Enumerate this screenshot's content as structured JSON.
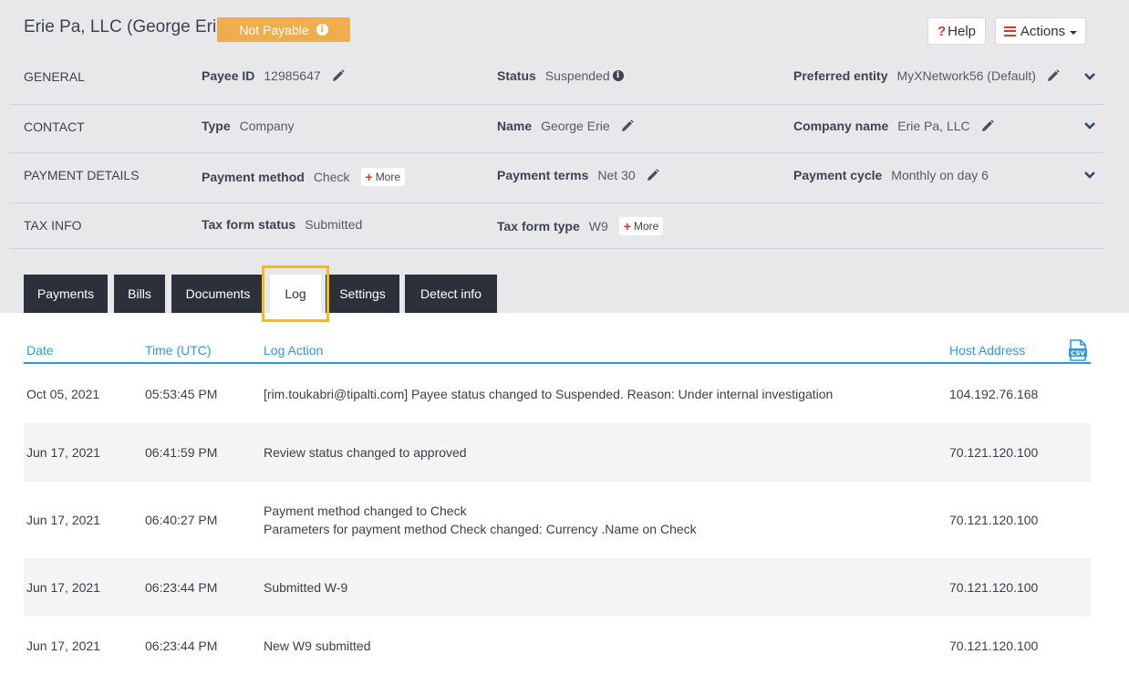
{
  "header": {
    "title": "Erie Pa, LLC (George Erie)",
    "badge": "Not Payable",
    "help_label": "Help",
    "help_mark": "?",
    "actions_label": "Actions"
  },
  "general": {
    "section": "GENERAL",
    "payee_id_label": "Payee ID",
    "payee_id_value": "12985647",
    "status_label": "Status",
    "status_value": "Suspended",
    "entity_label": "Preferred entity",
    "entity_value": "MyXNetwork56 (Default)"
  },
  "contact": {
    "section": "CONTACT",
    "type_label": "Type",
    "type_value": "Company",
    "name_label": "Name",
    "name_value": "George Erie",
    "company_label": "Company name",
    "company_value": "Erie Pa, LLC"
  },
  "payment": {
    "section": "PAYMENT DETAILS",
    "method_label": "Payment method",
    "method_value": "Check",
    "more_label": "More",
    "terms_label": "Payment terms",
    "terms_value": "Net 30",
    "cycle_label": "Payment cycle",
    "cycle_value": "Monthly on day 6"
  },
  "tax": {
    "section": "TAX INFO",
    "status_label": "Tax form status",
    "status_value": "Submitted",
    "type_label": "Tax form type",
    "type_value": "W9",
    "more_label": "More"
  },
  "tabs": [
    "Payments",
    "Bills",
    "Documents",
    "Log",
    "Settings",
    "Detect info"
  ],
  "log": {
    "columns": {
      "date": "Date",
      "time": "Time (UTC)",
      "action": "Log Action",
      "host": "Host Address"
    },
    "csv_label": "CSV",
    "rows": [
      {
        "date": "Oct 05, 2021",
        "time": "05:53:45 PM",
        "action1": "[rim.toukabri@tipalti.com] Payee status changed to Suspended. Reason: Under internal investigation",
        "action2": "",
        "host": "104.192.76.168"
      },
      {
        "date": "Jun 17, 2021",
        "time": "06:41:59 PM",
        "action1": "Review status changed to approved",
        "action2": "",
        "host": "70.121.120.100"
      },
      {
        "date": "Jun 17, 2021",
        "time": "06:40:27 PM",
        "action1": "Payment method changed to Check",
        "action2": "Parameters for payment method Check changed: Currency .Name on Check",
        "host": "70.121.120.100"
      },
      {
        "date": "Jun 17, 2021",
        "time": "06:23:44 PM",
        "action1": "Submitted W-9",
        "action2": "",
        "host": "70.121.120.100"
      },
      {
        "date": "Jun 17, 2021",
        "time": "06:23:44 PM",
        "action1": "New W9 submitted",
        "action2": "",
        "host": "70.121.120.100"
      }
    ]
  },
  "colors": {
    "badge": "#f0ad4e",
    "tab_bg": "#2b303b",
    "accent_blue": "#2e9bd6",
    "highlight": "#f3bb1c",
    "red": "#d9332d"
  }
}
